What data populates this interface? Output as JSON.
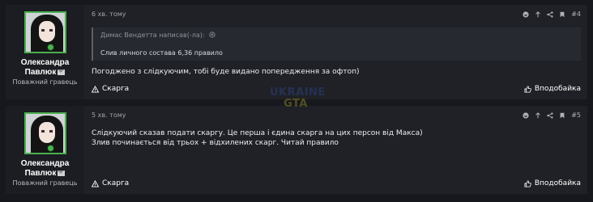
{
  "posts": [
    {
      "user": {
        "name_line1": "Олександра",
        "name_line2": "Павлюк",
        "rank": "Поважний гравець"
      },
      "time": "6 хв. тому",
      "post_number": "#4",
      "quote": {
        "header": "Димас Вендетта написав(-ла):",
        "text": "Слив личного состава 6,36 правило"
      },
      "text_lines": [
        "Погоджено з слідкуючим, тобі буде видано попередження за офтоп)"
      ],
      "report_label": "Скарга",
      "like_label": "Вподобайка"
    },
    {
      "user": {
        "name_line1": "Олександра",
        "name_line2": "Павлюк",
        "rank": "Поважний гравець"
      },
      "time": "5 хв. тому",
      "post_number": "#5",
      "text_lines": [
        "Слідкуючий сказав подати скаргу. Це перша і єдина скарга на цих персон від Макса)",
        "Злив починається від трьох + відхилених скарг. Читай правило"
      ],
      "report_label": "Скарга",
      "like_label": "Вподобайка"
    }
  ],
  "watermark": {
    "line1": "UKRAINE",
    "line2": "GTA"
  },
  "colors": {
    "background": "#16181d",
    "post_bg": "#1f2126",
    "avatar_border": "#4caf50",
    "watermark_blue": "#2a3f78",
    "watermark_gold": "#8a7a25"
  }
}
